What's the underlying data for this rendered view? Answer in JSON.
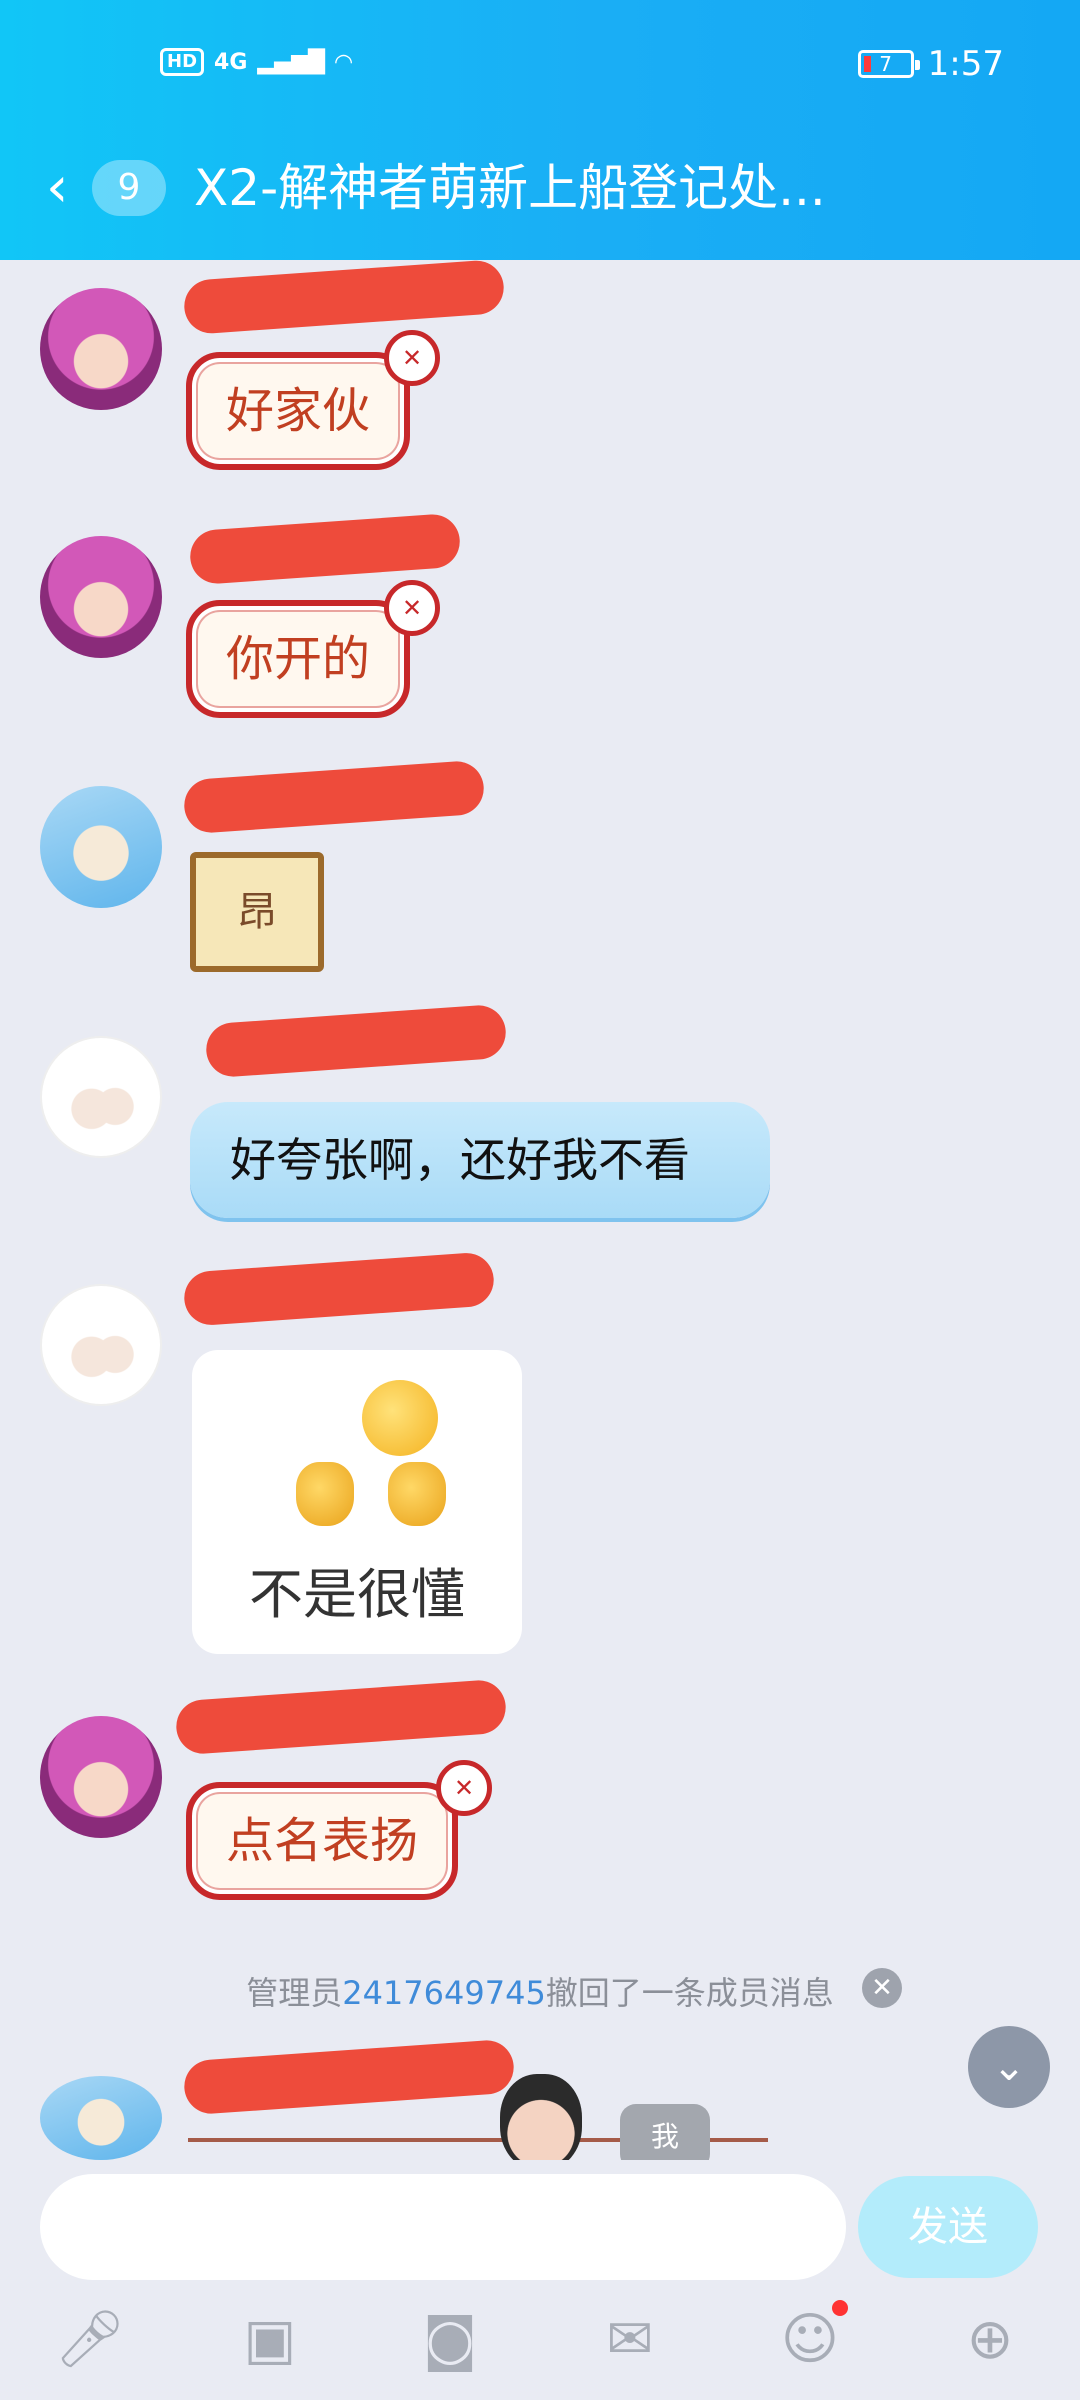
{
  "status_bar": {
    "hd": "HD",
    "network": "4G",
    "battery": "7",
    "time": "1:57"
  },
  "header": {
    "back_icon": "‹",
    "unread_count": "9",
    "title": "X2-解神者萌新上船登记处..."
  },
  "messages": [
    {
      "text": "好家伙"
    },
    {
      "text": "你开的"
    },
    {
      "sticker_text": "昂"
    },
    {
      "text": "好夸张啊，还好我不看"
    },
    {
      "image_caption": "不是很懂"
    },
    {
      "text": "点名表扬"
    }
  ],
  "system_notice": {
    "prefix": "管理员",
    "admin_id": "2417649745",
    "suffix": "撤回了一条成员消息"
  },
  "mini": {
    "me_label": "我"
  },
  "input_bar": {
    "placeholder": "",
    "send_label": "发送"
  }
}
